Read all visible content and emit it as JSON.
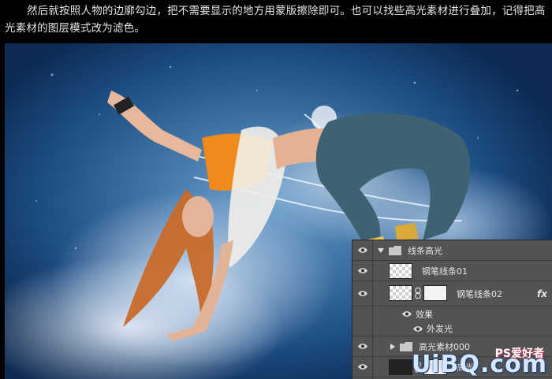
{
  "article": {
    "paragraph": "然后就按照人物的边廓勾边，把不需要显示的地方用蒙版擦除即可。也可以找些高光素材进行叠加，记得把高光素材的图层模式改为滤色。"
  },
  "layers_panel": {
    "rows": [
      {
        "type": "group",
        "name": "线条高光",
        "expanded": true,
        "visible": true
      },
      {
        "type": "layer",
        "name": "钢笔线条01",
        "visible": true
      },
      {
        "type": "layer-masked",
        "name": "钢笔线条02",
        "visible": true,
        "fx": "fx"
      },
      {
        "type": "effects",
        "name": "效果",
        "visible": true
      },
      {
        "type": "effect",
        "name": "外发光",
        "visible": true
      },
      {
        "type": "group",
        "name": "高光素材000",
        "expanded": false,
        "visible": true
      },
      {
        "type": "layer-masked",
        "name": "高光",
        "visible": true
      },
      {
        "type": "layer-masked",
        "name": "",
        "visible": true
      }
    ]
  },
  "watermark": {
    "logo": "UiBQ.com",
    "site": "PS爱好者"
  },
  "colors": {
    "panel_bg": "#535353",
    "panel_text": "#e8e8e8",
    "sky_blue": "#1d4e84",
    "top_orange": "#f08a1c"
  },
  "icons": {
    "visibility": "eye-icon",
    "group": "folder-icon",
    "link": "chain-icon",
    "disclosure": "triangle-icon"
  }
}
